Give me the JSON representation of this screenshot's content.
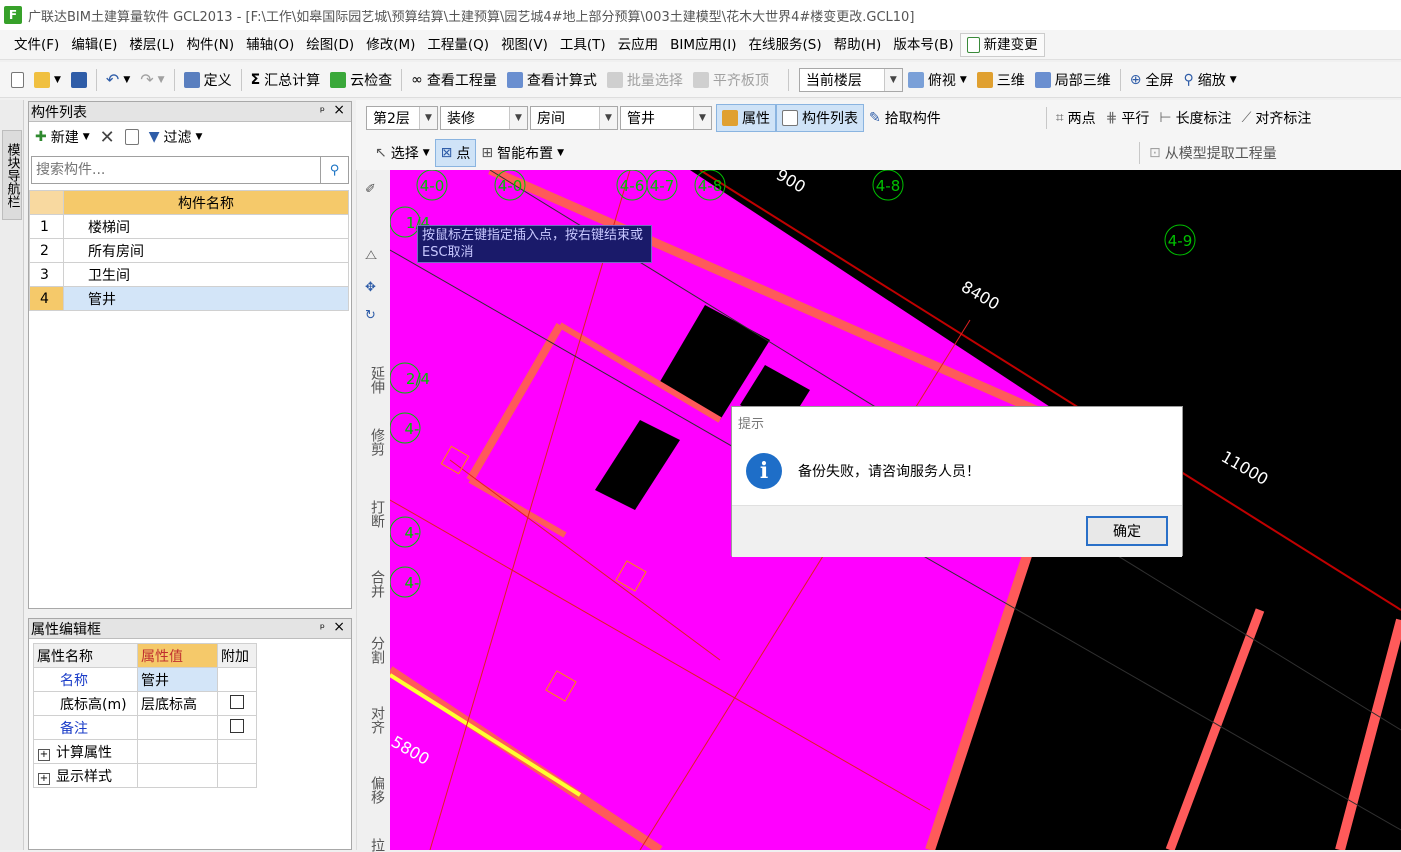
{
  "window": {
    "title": "广联达BIM土建算量软件 GCL2013 - [F:\\工作\\如皋国际园艺城\\预算结算\\土建预算\\园艺城4#地上部分预算\\003土建模型\\花木大世界4#楼变更改.GCL10]",
    "app_icon_letter": "F"
  },
  "menu": [
    "文件(F)",
    "编辑(E)",
    "楼层(L)",
    "构件(N)",
    "辅轴(O)",
    "绘图(D)",
    "修改(M)",
    "工程量(Q)",
    "视图(V)",
    "工具(T)",
    "云应用",
    "BIM应用(I)",
    "在线服务(S)",
    "帮助(H)",
    "版本号(B)"
  ],
  "menu_highlight": "新建变更",
  "toolbar1": {
    "define": "定义",
    "sum_calc": "汇总计算",
    "cloud_check": "云检查",
    "view_quantity": "查看工程量",
    "view_formula": "查看计算式",
    "batch_select": "批量选择",
    "flat_slab": "平齐板顶",
    "floor_select": "当前楼层",
    "top_view": "俯视",
    "three_d": "三维",
    "local_3d": "局部三维",
    "fullscreen": "全屏",
    "zoom": "缩放"
  },
  "toolbar2": {
    "floor": "第2层",
    "category": "装修",
    "type": "房间",
    "component": "管井",
    "property": "属性",
    "component_list": "构件列表",
    "pick_component": "拾取构件",
    "two_points": "两点",
    "parallel": "平行",
    "length_dim": "长度标注",
    "align_dim": "对齐标注"
  },
  "toolbar3": {
    "select": "选择",
    "point": "点",
    "smart_layout": "智能布置",
    "extract": "从模型提取工程量"
  },
  "nav_tab": "模块导航栏",
  "component_panel": {
    "title": "构件列表",
    "new_label": "新建",
    "filter_label": "过滤",
    "search_placeholder": "搜索构件...",
    "column_header": "构件名称",
    "rows": [
      {
        "idx": "1",
        "name": "楼梯间"
      },
      {
        "idx": "2",
        "name": "所有房间"
      },
      {
        "idx": "3",
        "name": "卫生间"
      },
      {
        "idx": "4",
        "name": "管井"
      }
    ],
    "selected_index": 3
  },
  "property_panel": {
    "title": "属性编辑框",
    "headers": [
      "属性名称",
      "属性值",
      "附加"
    ],
    "rows": [
      {
        "name": "名称",
        "value": "管井",
        "blue": true,
        "check": false,
        "show_check": false
      },
      {
        "name": "底标高(m)",
        "value": "层底标高",
        "blue": false,
        "check": false,
        "show_check": true
      },
      {
        "name": "备注",
        "value": "",
        "blue": true,
        "check": false,
        "show_check": true
      },
      {
        "name": "计算属性",
        "value": "",
        "blue": false,
        "expand": true,
        "show_check": false
      },
      {
        "name": "显示样式",
        "value": "",
        "blue": false,
        "expand": true,
        "show_check": false
      }
    ]
  },
  "vertical_tools": [
    "延伸",
    "修剪",
    "打断",
    "合并",
    "分割",
    "对齐",
    "偏移",
    "拉"
  ],
  "canvas": {
    "axis_labels": [
      "4-0",
      "4-0",
      "4-6",
      "4-7",
      "4-8",
      "4-8",
      "4-9",
      "1/4",
      "2/4",
      "4-",
      "4-",
      "4-"
    ],
    "dimensions": [
      "8400",
      "11000",
      "5800",
      "900"
    ],
    "colors": {
      "slab": "#ff00ff",
      "wall": "#ff5a5a",
      "axis": "#00c000",
      "background": "#000000"
    }
  },
  "tooltip": "按鼠标左键指定插入点，按右键结束或ESC取消",
  "dialog": {
    "title": "提示",
    "message": "备份失败，请咨询服务人员！",
    "ok": "确定"
  }
}
